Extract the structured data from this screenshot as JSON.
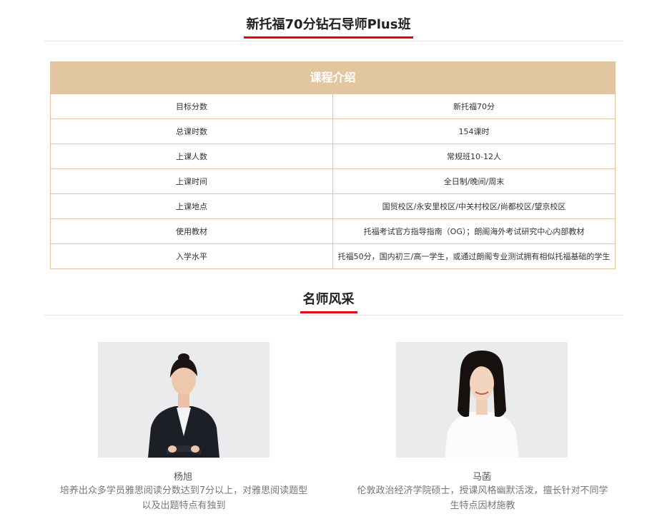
{
  "course_section": {
    "title": "新托福70分钻石导师Plus班"
  },
  "course_table": {
    "header": "课程介绍",
    "rows": [
      {
        "label": "目标分数",
        "value": "新托福70分"
      },
      {
        "label": "总课时数",
        "value": "154课时"
      },
      {
        "label": "上课人数",
        "value": "常规班10-12人"
      },
      {
        "label": "上课时间",
        "value": "全日制/晚间/周末"
      },
      {
        "label": "上课地点",
        "value": "国贸校区/永安里校区/中关村校区/尚都校区/望京校区"
      },
      {
        "label": "使用教材",
        "value": "托福考试官方指导指南（OG）；朗阁海外考试研究中心内部教材"
      },
      {
        "label": "入学水平",
        "value": "托福50分，国内初三/高一学生，或通过朗阁专业测试拥有相似托福基础的学生"
      }
    ]
  },
  "teachers_section": {
    "title": "名师风采"
  },
  "teachers": [
    {
      "name": "杨旭",
      "desc_line1": "培养出众多学员雅思阅读分数达到7分以上，对雅思阅读题型",
      "desc_line2": "以及出题特点有独到"
    },
    {
      "name": "马菡",
      "desc_line1": "伦敦政治经济学院硕士，授课风格幽默活泼，擅长针对不同学",
      "desc_line2": "生特点因材施教"
    }
  ]
}
